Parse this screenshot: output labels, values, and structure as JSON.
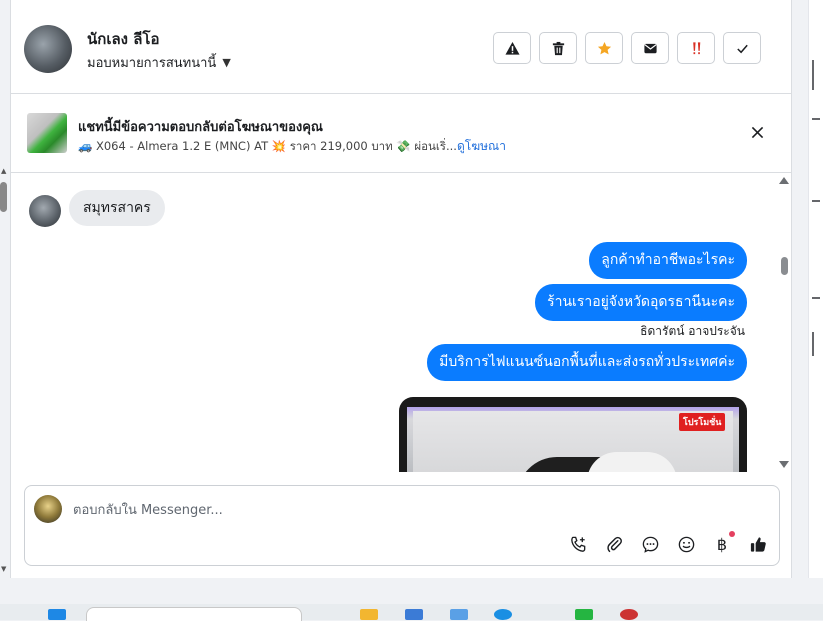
{
  "header": {
    "contact_name": "นักเลง ลีโอ",
    "assign_label": "มอบหมายการสนทนานี้",
    "actions": [
      "alert-icon",
      "trash-icon",
      "star-icon",
      "mail-icon",
      "priority-icon",
      "check-icon"
    ]
  },
  "ad": {
    "title": "แชทนี้มีข้อความตอบกลับต่อโฆษณาของคุณ",
    "detail_model": "X064 - Almera 1.2 E (MNC) AT",
    "detail_price": "ราคา 219,000 บาท",
    "detail_more": "ผ่อนเริ่...",
    "link": "ดูโฆษณา"
  },
  "messages": {
    "incoming_1": "สมุทรสาคร",
    "outgoing_1": "ลูกค้าทำอาชีพอะไรคะ",
    "outgoing_2": "ร้านเราอยู่จังหวัดอุดรธานีนะคะ",
    "sender_name": "ธิดารัตน์ อาจประจัน",
    "outgoing_3": "มีบริการไฟแนนซ์นอกพื้นที่และส่งรถทั่วประเทศค่ะ",
    "image_tag": "โปรโมชั่น"
  },
  "composer": {
    "placeholder": "ตอบกลับใน Messenger...",
    "value": "",
    "tools": [
      "call-icon",
      "attach-icon",
      "saved-replies-icon",
      "emoji-icon",
      "payment-icon",
      "like-icon"
    ],
    "currency_symbol": "฿"
  },
  "colors": {
    "accent": "#0a7cff",
    "link": "#216fdb",
    "star": "#f5a623",
    "priority": "#d93025",
    "notification": "#e4405f"
  }
}
